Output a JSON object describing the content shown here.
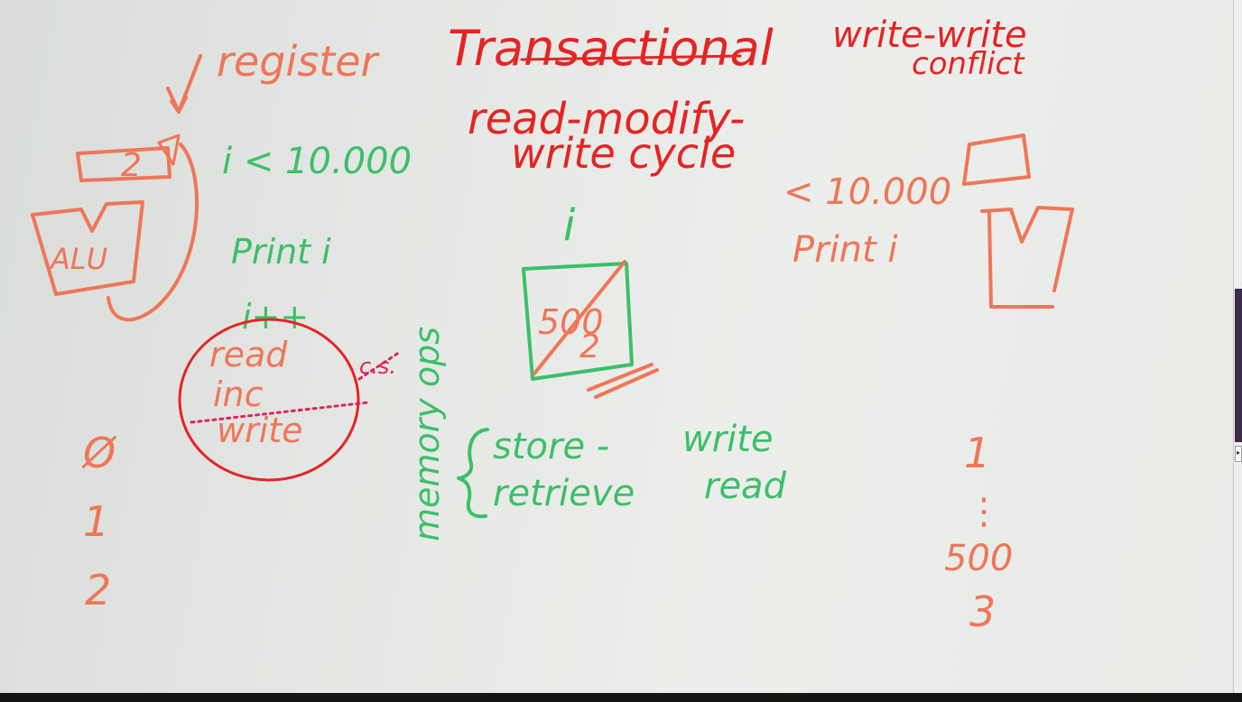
{
  "title": {
    "transactional": "Transactional",
    "read_modify": "read-modify-",
    "write_cycle": "write cycle"
  },
  "conflict": {
    "line1": "write-write",
    "line2": "conflict"
  },
  "register": {
    "label": "register",
    "value": "2",
    "alu": "ALU"
  },
  "loop_code": {
    "cond": "i < 10.000",
    "print": "Print i",
    "incr": "i++"
  },
  "rmw_steps": {
    "read": "read",
    "inc": "inc",
    "write": "write",
    "cs": "c.s."
  },
  "left_sequence": [
    "Ø",
    "1",
    "2"
  ],
  "memory": {
    "variable": "i",
    "old_value": "500",
    "new_value": "2",
    "ops_label": "memory ops",
    "store": "store -",
    "store_meaning": "write",
    "retrieve": "retrieve",
    "retrieve_meaning": "read"
  },
  "right_thread": {
    "cond": "< 10.000",
    "print": "Print i"
  },
  "right_sequence": [
    "1",
    "⋮",
    "500",
    "3"
  ],
  "colors": {
    "red_marker": "#e52424",
    "orange_marker": "#ef7658",
    "green_marker": "#3cbf6a",
    "board": "#e8eae7"
  }
}
